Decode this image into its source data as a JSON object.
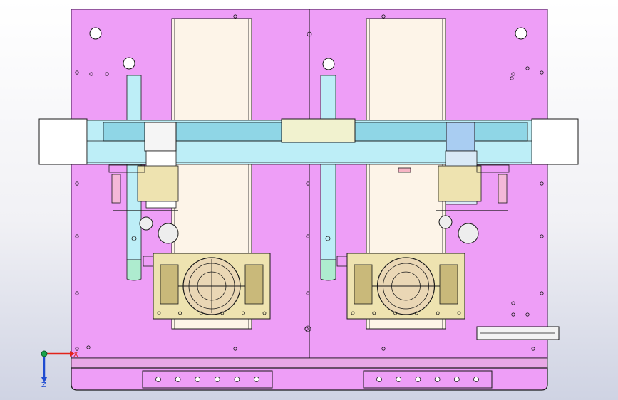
{
  "viewport": {
    "background_top": "#ffffff",
    "background_bottom": "#cfd3e3"
  },
  "colors": {
    "plate": "#ee9ef7",
    "plate_edge": "#5a2a66",
    "bottom_strip": "#e8a8e6",
    "belt": "#fdf4e8",
    "rail": "#bdeef7",
    "rail_dark": "#8fd6e6",
    "gold": "#eee3b0",
    "gold_dark": "#c9b97a",
    "block_white": "#ffffff",
    "carriage": "#a9cdf2",
    "slot": "#f7b5c5",
    "line": "#1a1a1a"
  },
  "triad": {
    "x_label": "X",
    "z_label": "Z",
    "x_color": "#e2231a",
    "y_color": "#18a34a",
    "z_color": "#1f4bd1"
  }
}
